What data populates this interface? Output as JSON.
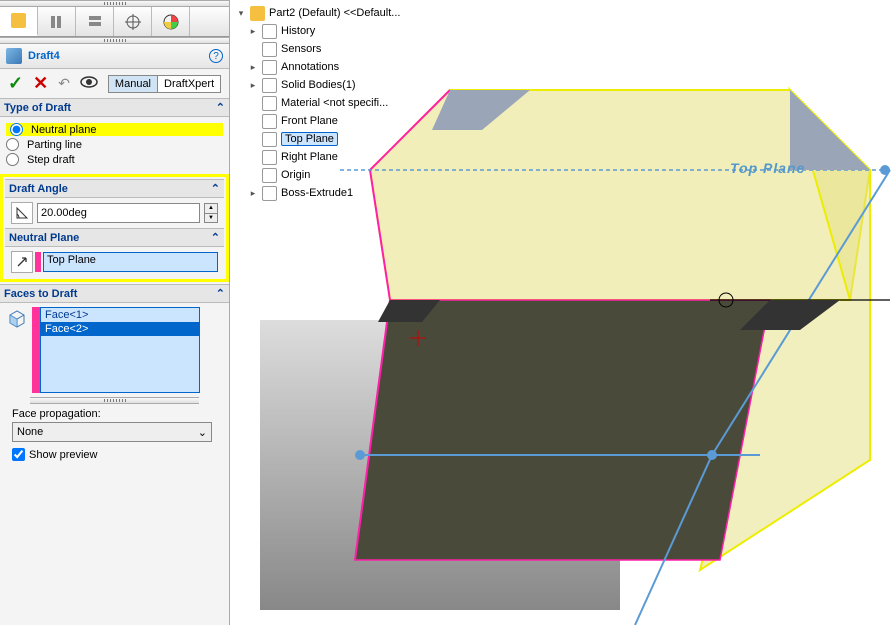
{
  "header": {
    "title": "Draft4"
  },
  "actions": {
    "mode_manual": "Manual",
    "mode_expert": "DraftXpert"
  },
  "type_of_draft": {
    "header": "Type of Draft",
    "opt_neutral": "Neutral plane",
    "opt_parting": "Parting line",
    "opt_step": "Step draft"
  },
  "draft_angle": {
    "header": "Draft Angle",
    "value": "20.00deg"
  },
  "neutral_plane": {
    "header": "Neutral Plane",
    "value": "Top Plane"
  },
  "faces": {
    "header": "Faces to Draft",
    "items": [
      "Face<1>",
      "Face<2>"
    ],
    "propagation_label": "Face propagation:",
    "propagation_value": "None",
    "show_preview": "Show preview"
  },
  "tree": {
    "root": "Part2 (Default) <<Default...",
    "history": "History",
    "sensors": "Sensors",
    "annotations": "Annotations",
    "solid_bodies": "Solid Bodies(1)",
    "material": "Material <not specifi...",
    "front": "Front Plane",
    "top": "Top Plane",
    "right": "Right Plane",
    "origin": "Origin",
    "boss": "Boss-Extrude1"
  },
  "viewport": {
    "top_plane_label": "Top Plane"
  }
}
